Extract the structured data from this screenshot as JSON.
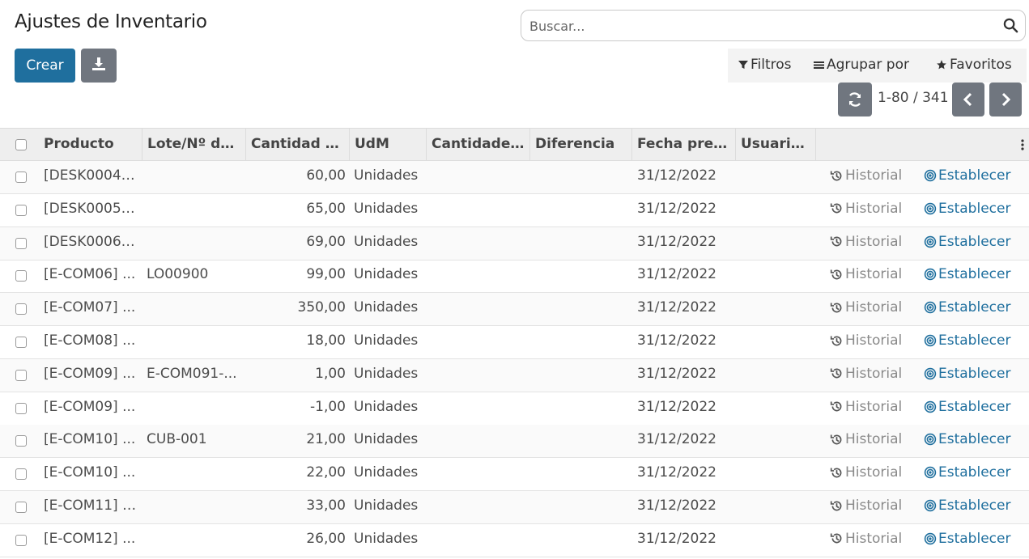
{
  "page": {
    "title": "Ajustes de Inventario"
  },
  "search": {
    "placeholder": "Buscar..."
  },
  "toolbar": {
    "create_label": "Crear"
  },
  "filters": {
    "filters_label": "Filtros",
    "group_label": "Agrupar por",
    "favorites_label": "Favoritos"
  },
  "pager": {
    "value": "1-80 / 341"
  },
  "table": {
    "columns": [
      "Producto",
      "Lote/Nº de ...",
      "Cantidad a...",
      "UdM",
      "Cantidade ...",
      "Diferencia",
      "Fecha prev...",
      "Usuario..."
    ],
    "rows": [
      {
        "product": "[DESK0004]...",
        "lot": "",
        "qty": "60,00",
        "uom": "Unidades",
        "date": "31/12/2022",
        "history": "Historial",
        "set": "Establecer"
      },
      {
        "product": "[DESK0005]...",
        "lot": "",
        "qty": "65,00",
        "uom": "Unidades",
        "date": "31/12/2022",
        "history": "Historial",
        "set": "Establecer"
      },
      {
        "product": "[DESK0006]...",
        "lot": "",
        "qty": "69,00",
        "uom": "Unidades",
        "date": "31/12/2022",
        "history": "Historial",
        "set": "Establecer"
      },
      {
        "product": "[E-COM06] ...",
        "lot": "LO00900",
        "qty": "99,00",
        "uom": "Unidades",
        "date": "31/12/2022",
        "history": "Historial",
        "set": "Establecer"
      },
      {
        "product": "[E-COM07] ...",
        "lot": "",
        "qty": "350,00",
        "uom": "Unidades",
        "date": "31/12/2022",
        "history": "Historial",
        "set": "Establecer"
      },
      {
        "product": "[E-COM08] ...",
        "lot": "",
        "qty": "18,00",
        "uom": "Unidades",
        "date": "31/12/2022",
        "history": "Historial",
        "set": "Establecer"
      },
      {
        "product": "[E-COM09] ...",
        "lot": "E-COM091-...",
        "qty": "1,00",
        "uom": "Unidades",
        "date": "31/12/2022",
        "history": "Historial",
        "set": "Establecer"
      },
      {
        "product": "[E-COM09] ...",
        "lot": "",
        "qty": "-1,00",
        "uom": "Unidades",
        "date": "31/12/2022",
        "history": "Historial",
        "set": "Establecer"
      },
      {
        "product": "[E-COM10] ...",
        "lot": "CUB-001",
        "qty": "21,00",
        "uom": "Unidades",
        "date": "31/12/2022",
        "history": "Historial",
        "set": "Establecer"
      },
      {
        "product": "[E-COM10] ...",
        "lot": "",
        "qty": "22,00",
        "uom": "Unidades",
        "date": "31/12/2022",
        "history": "Historial",
        "set": "Establecer"
      },
      {
        "product": "[E-COM11] A...",
        "lot": "",
        "qty": "33,00",
        "uom": "Unidades",
        "date": "31/12/2022",
        "history": "Historial",
        "set": "Establecer"
      },
      {
        "product": "[E-COM12] ...",
        "lot": "",
        "qty": "26,00",
        "uom": "Unidades",
        "date": "31/12/2022",
        "history": "Historial",
        "set": "Establecer"
      }
    ]
  },
  "icons": {
    "search": "search-icon",
    "download": "download-icon",
    "filter": "filter-icon",
    "group": "group-by-icon",
    "favorites": "star-icon",
    "refresh": "refresh-icon",
    "prev": "chevron-left-icon",
    "next": "chevron-right-icon",
    "history": "history-icon",
    "set": "target-icon",
    "kebab": "kebab-menu-icon"
  },
  "colors": {
    "primary": "#1f6f9e",
    "secondary": "#70767f"
  }
}
